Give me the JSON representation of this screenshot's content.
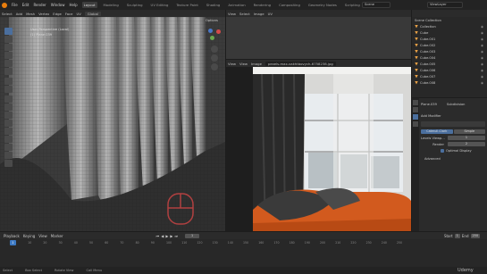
{
  "topbar": {
    "menus": [
      "File",
      "Edit",
      "Render",
      "Window",
      "Help"
    ],
    "tabs": [
      "Layout",
      "Modeling",
      "Sculpting",
      "UV Editing",
      "Texture Paint",
      "Shading",
      "Animation",
      "Rendering",
      "Compositing",
      "Geometry Nodes",
      "Scripting"
    ],
    "active_tab": "Layout",
    "scene": "Scene",
    "view_layer": "ViewLayer"
  },
  "viewport": {
    "header_items": [
      "Select",
      "Add",
      "Mesh",
      "Vertex",
      "Edge",
      "Face",
      "UV",
      "Global"
    ],
    "overlay_line1": "User Perspective (Local)",
    "overlay_line2": "(1) Plane.039",
    "options_label": "Options"
  },
  "image_editor_top": {
    "header_items": [
      "View",
      "Select",
      "Image",
      "UV"
    ]
  },
  "image_editor": {
    "header_items": [
      "View",
      "View",
      "Image"
    ],
    "filename": "pexels-max-vakhtbovych-6758238.jpg"
  },
  "outliner": {
    "title": "Scene Collection",
    "rows": [
      "Collection",
      "Cube",
      "Cube.001",
      "Cube.002",
      "Cube.003",
      "Cube.004",
      "Cube.005",
      "Cube.006",
      "Cube.007",
      "Cube.008"
    ]
  },
  "properties": {
    "object_name": "Plane.039",
    "modifier_type": "Subdivision",
    "add_modifier": "Add Modifier",
    "tab_catmull": "Catmull-Clark",
    "tab_simple": "Simple",
    "levels_viewport_label": "Levels Viewp...",
    "levels_viewport_value": "1",
    "render_label": "Render",
    "render_value": "2",
    "optimal_display": "Optimal Display",
    "advanced": "Advanced"
  },
  "timeline": {
    "menus": [
      "Playback",
      "Keying",
      "View",
      "Marker"
    ],
    "current_frame": "1",
    "start_label": "Start",
    "start": "1",
    "end_label": "End",
    "end": "250",
    "ticks": [
      "0",
      "10",
      "20",
      "30",
      "40",
      "50",
      "60",
      "70",
      "80",
      "90",
      "100",
      "110",
      "120",
      "130",
      "140",
      "150",
      "160",
      "170",
      "180",
      "190",
      "200",
      "210",
      "220",
      "230",
      "240",
      "250"
    ]
  },
  "statusbar": {
    "items": [
      "Select",
      "Box Select",
      "Rotate View",
      "Call Menu"
    ]
  },
  "watermark": "Udemy",
  "colors": {
    "accent": "#4b6f9e",
    "orange": "#e87d0d",
    "playhead": "#3d7ac4"
  }
}
